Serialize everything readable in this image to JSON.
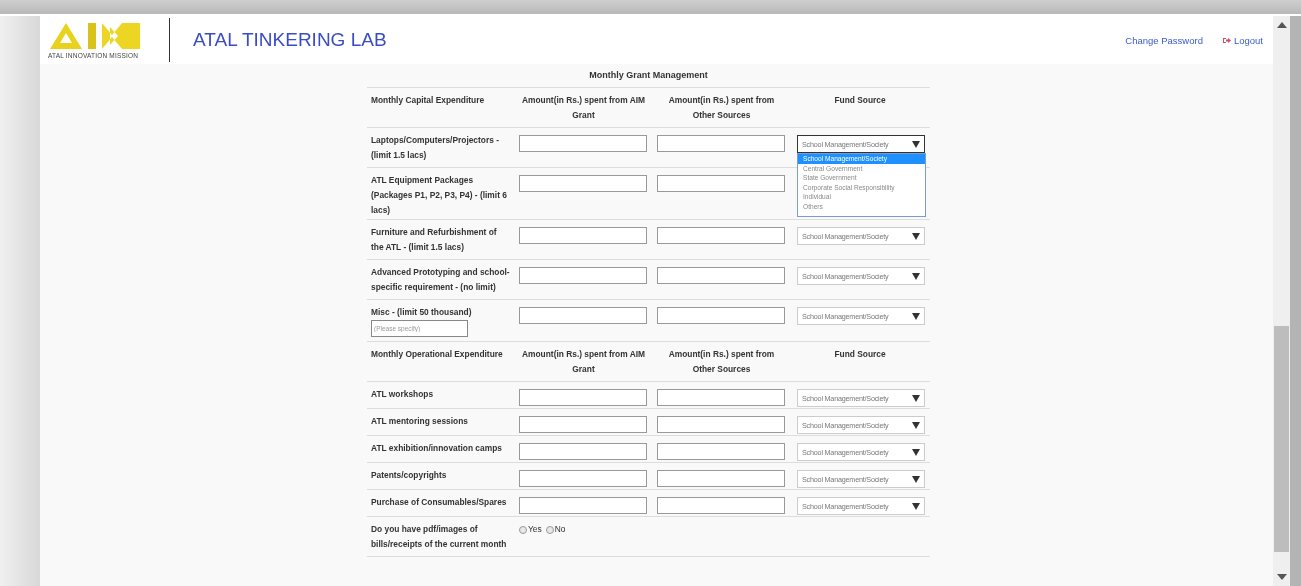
{
  "header": {
    "logo_caption": "ATAL INNOVATION MISSION",
    "title": "ATAL TINKERING LAB",
    "links": [
      {
        "label": "Change Password",
        "kind": "text"
      },
      {
        "label": "Logout",
        "kind": "icon"
      }
    ]
  },
  "form": {
    "title": "Monthly Grant Management",
    "sections": [
      {
        "heading": "Monthly Capital Expenditure",
        "columns": [
          "Amount(in Rs.) spent from AIM Grant",
          "Amount(in Rs.) spent from Other Sources",
          "Fund Source"
        ],
        "rows": [
          {
            "label": "Laptops/Computers/Projectors - (limit 1.5 lacs)",
            "fund": "School Management/Society",
            "expanded": true,
            "options": [
              {
                "label": "School Management/Society",
                "selected": true
              },
              {
                "label": "Central Government",
                "selected": false
              },
              {
                "label": "State Government",
                "selected": false
              },
              {
                "label": "Corporate Social Responsibility",
                "selected": false
              },
              {
                "label": "Individual",
                "selected": false
              },
              {
                "label": "Others",
                "selected": false
              }
            ]
          },
          {
            "label": "ATL Equipment Packages (Packages P1, P2, P3, P4) - (limit 6 lacs)"
          },
          {
            "label": "Furniture and Refurbishment of the ATL - (limit 1.5 lacs)",
            "fund": "School Management/Society",
            "expanded": false
          },
          {
            "label": "Advanced Prototyping and school-specific requirement - (no limit)",
            "fund": "School Management/Society",
            "expanded": false
          },
          {
            "label": "Misc - (limit 50 thousand)",
            "placeholder": "(Please specify)",
            "fund": "School Management/Society",
            "expanded": false
          }
        ]
      },
      {
        "heading": "Monthly Operational Expenditure",
        "columns": [
          "Amount(in Rs.) spent from AIM Grant",
          "Amount(in Rs.) spent from Other Sources",
          "Fund Source"
        ],
        "rows": [
          {
            "label": "ATL workshops",
            "fund": "School Management/Society",
            "expanded": false
          },
          {
            "label": "ATL mentoring sessions",
            "fund": "School Management/Society",
            "expanded": false
          },
          {
            "label": "ATL exhibition/innovation camps",
            "fund": "School Management/Society",
            "expanded": false
          },
          {
            "label": "Patents/copyrights",
            "fund": "School Management/Society",
            "expanded": false
          },
          {
            "label": "Purchase of Consumables/Spares",
            "fund": "School Management/Society",
            "expanded": false
          }
        ]
      }
    ],
    "question": {
      "label": "Do you have pdf/images of bills/receipts of the current month",
      "options": [
        {
          "label": "Yes",
          "selected": false
        },
        {
          "label": "No",
          "selected": false
        }
      ]
    }
  }
}
